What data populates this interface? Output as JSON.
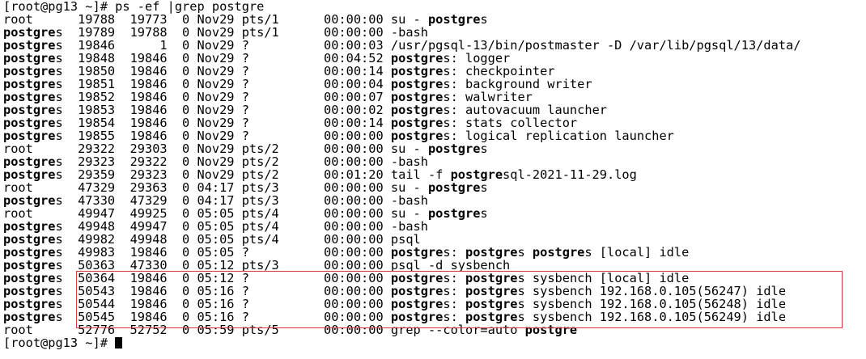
{
  "terminal": {
    "command_prompt": "[root@pg13 ~]# ",
    "command": "ps -ef |grep postgre",
    "final_prompt": "[root@pg13 ~]# ",
    "bold_match": "postgre",
    "highlight_color": "#d9363e",
    "rows": [
      {
        "user": "root",
        "pid": "19788",
        "ppid": "19773",
        "c": "0",
        "stime": "Nov29",
        "tty": "pts/1",
        "time": "00:00:00",
        "cmd": "su - postgres",
        "highlighted": false
      },
      {
        "user": "postgres",
        "pid": "19789",
        "ppid": "19788",
        "c": "0",
        "stime": "Nov29",
        "tty": "pts/1",
        "time": "00:00:00",
        "cmd": "-bash",
        "highlighted": false
      },
      {
        "user": "postgres",
        "pid": "19846",
        "ppid": "1",
        "c": "0",
        "stime": "Nov29",
        "tty": "?",
        "time": "00:00:03",
        "cmd": "/usr/pgsql-13/bin/postmaster -D /var/lib/pgsql/13/data/",
        "highlighted": false
      },
      {
        "user": "postgres",
        "pid": "19848",
        "ppid": "19846",
        "c": "0",
        "stime": "Nov29",
        "tty": "?",
        "time": "00:04:52",
        "cmd": "postgres: logger",
        "highlighted": false
      },
      {
        "user": "postgres",
        "pid": "19850",
        "ppid": "19846",
        "c": "0",
        "stime": "Nov29",
        "tty": "?",
        "time": "00:00:14",
        "cmd": "postgres: checkpointer",
        "highlighted": false
      },
      {
        "user": "postgres",
        "pid": "19851",
        "ppid": "19846",
        "c": "0",
        "stime": "Nov29",
        "tty": "?",
        "time": "00:00:04",
        "cmd": "postgres: background writer",
        "highlighted": false
      },
      {
        "user": "postgres",
        "pid": "19852",
        "ppid": "19846",
        "c": "0",
        "stime": "Nov29",
        "tty": "?",
        "time": "00:00:07",
        "cmd": "postgres: walwriter",
        "highlighted": false
      },
      {
        "user": "postgres",
        "pid": "19853",
        "ppid": "19846",
        "c": "0",
        "stime": "Nov29",
        "tty": "?",
        "time": "00:00:02",
        "cmd": "postgres: autovacuum launcher",
        "highlighted": false
      },
      {
        "user": "postgres",
        "pid": "19854",
        "ppid": "19846",
        "c": "0",
        "stime": "Nov29",
        "tty": "?",
        "time": "00:00:14",
        "cmd": "postgres: stats collector",
        "highlighted": false
      },
      {
        "user": "postgres",
        "pid": "19855",
        "ppid": "19846",
        "c": "0",
        "stime": "Nov29",
        "tty": "?",
        "time": "00:00:00",
        "cmd": "postgres: logical replication launcher",
        "highlighted": false
      },
      {
        "user": "root",
        "pid": "29322",
        "ppid": "29303",
        "c": "0",
        "stime": "Nov29",
        "tty": "pts/2",
        "time": "00:00:00",
        "cmd": "su - postgres",
        "highlighted": false
      },
      {
        "user": "postgres",
        "pid": "29323",
        "ppid": "29322",
        "c": "0",
        "stime": "Nov29",
        "tty": "pts/2",
        "time": "00:00:00",
        "cmd": "-bash",
        "highlighted": false
      },
      {
        "user": "postgres",
        "pid": "29359",
        "ppid": "29323",
        "c": "0",
        "stime": "Nov29",
        "tty": "pts/2",
        "time": "00:01:20",
        "cmd": "tail -f postgresql-2021-11-29.log",
        "highlighted": false
      },
      {
        "user": "root",
        "pid": "47329",
        "ppid": "29363",
        "c": "0",
        "stime": "04:17",
        "tty": "pts/3",
        "time": "00:00:00",
        "cmd": "su - postgres",
        "highlighted": false
      },
      {
        "user": "postgres",
        "pid": "47330",
        "ppid": "47329",
        "c": "0",
        "stime": "04:17",
        "tty": "pts/3",
        "time": "00:00:00",
        "cmd": "-bash",
        "highlighted": false
      },
      {
        "user": "root",
        "pid": "49947",
        "ppid": "49925",
        "c": "0",
        "stime": "05:05",
        "tty": "pts/4",
        "time": "00:00:00",
        "cmd": "su - postgres",
        "highlighted": false
      },
      {
        "user": "postgres",
        "pid": "49948",
        "ppid": "49947",
        "c": "0",
        "stime": "05:05",
        "tty": "pts/4",
        "time": "00:00:00",
        "cmd": "-bash",
        "highlighted": false
      },
      {
        "user": "postgres",
        "pid": "49982",
        "ppid": "49948",
        "c": "0",
        "stime": "05:05",
        "tty": "pts/4",
        "time": "00:00:00",
        "cmd": "psql",
        "highlighted": false
      },
      {
        "user": "postgres",
        "pid": "49983",
        "ppid": "19846",
        "c": "0",
        "stime": "05:05",
        "tty": "?",
        "time": "00:00:00",
        "cmd": "postgres: postgres postgres [local] idle",
        "highlighted": false
      },
      {
        "user": "postgres",
        "pid": "50363",
        "ppid": "47330",
        "c": "0",
        "stime": "05:12",
        "tty": "pts/3",
        "time": "00:00:00",
        "cmd": "psql -d sysbench",
        "highlighted": false
      },
      {
        "user": "postgres",
        "pid": "50364",
        "ppid": "19846",
        "c": "0",
        "stime": "05:12",
        "tty": "?",
        "time": "00:00:00",
        "cmd": "postgres: postgres sysbench [local] idle",
        "highlighted": true
      },
      {
        "user": "postgres",
        "pid": "50543",
        "ppid": "19846",
        "c": "0",
        "stime": "05:16",
        "tty": "?",
        "time": "00:00:00",
        "cmd": "postgres: postgres sysbench 192.168.0.105(56247) idle",
        "highlighted": true
      },
      {
        "user": "postgres",
        "pid": "50544",
        "ppid": "19846",
        "c": "0",
        "stime": "05:16",
        "tty": "?",
        "time": "00:00:00",
        "cmd": "postgres: postgres sysbench 192.168.0.105(56248) idle",
        "highlighted": true
      },
      {
        "user": "postgres",
        "pid": "50545",
        "ppid": "19846",
        "c": "0",
        "stime": "05:16",
        "tty": "?",
        "time": "00:00:00",
        "cmd": "postgres: postgres sysbench 192.168.0.105(56249) idle",
        "highlighted": true
      },
      {
        "user": "root",
        "pid": "52776",
        "ppid": "52752",
        "c": "0",
        "stime": "05:59",
        "tty": "pts/5",
        "time": "00:00:00",
        "cmd": "grep --color=auto postgre",
        "highlighted": false
      }
    ]
  }
}
